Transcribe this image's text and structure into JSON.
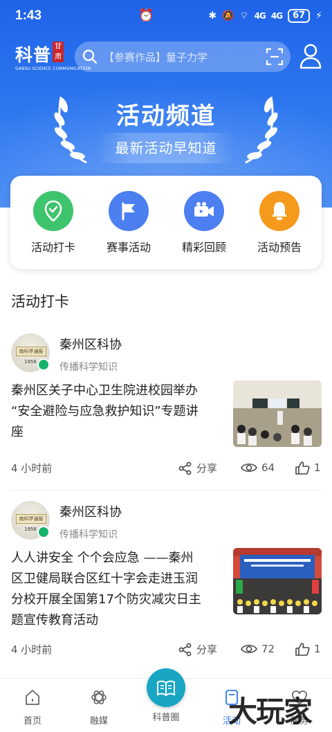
{
  "status_bar": {
    "time": "1:43",
    "signal_1": "4G",
    "signal_2": "4G",
    "battery": "67"
  },
  "header": {
    "logo_text": "科普",
    "logo_seal": "甘肃",
    "logo_subtitle": "GANSU SCIENCE COMMUNICATION",
    "search_placeholder": "【参赛作品】量子力学"
  },
  "banner": {
    "title": "活动频道",
    "subtitle": "最新活动早知道"
  },
  "quick_actions": [
    {
      "label": "活动打卡",
      "icon": "location-check-icon",
      "color": "#3ec46d"
    },
    {
      "label": "赛事活动",
      "icon": "flag-icon",
      "color": "#4c7ff0"
    },
    {
      "label": "精彩回顾",
      "icon": "video-camera-icon",
      "color": "#4c7ff0"
    },
    {
      "label": "活动预告",
      "icon": "bell-icon",
      "color": "#f59a1d"
    }
  ],
  "section_title": "活动打卡",
  "posts": [
    {
      "author": "秦州区科协",
      "slogan": "传播科学知识",
      "avatar_plate": "南科学通报",
      "avatar_year": "1956",
      "title_lines": [
        "秦州区关子中心卫生院进校园举办",
        "“安全避险与应急救护知识”专题讲",
        "座"
      ],
      "time": "4 小时前",
      "share_label": "分享",
      "views": "64",
      "likes": "1"
    },
    {
      "author": "秦州区科协",
      "slogan": "传播科学知识",
      "avatar_plate": "南科学通报",
      "avatar_year": "1956",
      "title_lines": [
        "人人讲安全 个个会应急 ——秦州",
        "区卫健局联合区红十字会走进玉润",
        "分校开展全国第17个防灾减灾日主",
        "题宣传教育活动"
      ],
      "time": "4 小时前",
      "share_label": "分享",
      "views": "72",
      "likes": "1"
    }
  ],
  "tabbar": {
    "tabs": [
      {
        "label": "首页",
        "icon": "home-icon"
      },
      {
        "label": "融媒",
        "icon": "media-icon"
      },
      {
        "label": "科普圈",
        "icon": "book-icon"
      },
      {
        "label": "活动",
        "icon": "activity-icon"
      },
      {
        "label": "服务",
        "icon": "service-icon"
      }
    ]
  },
  "watermark": "大玩家",
  "colors": {
    "primary": "#2f78f0",
    "accent_teal": "#19a6c5",
    "verified_green": "#16b36a"
  }
}
